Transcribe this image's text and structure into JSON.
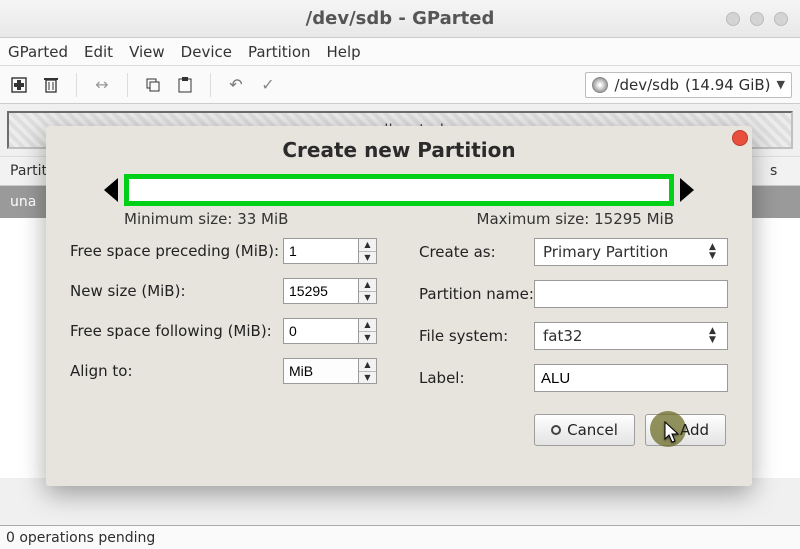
{
  "window": {
    "title": "/dev/sdb - GParted"
  },
  "menu": {
    "app": "GParted",
    "edit": "Edit",
    "view": "View",
    "device": "Device",
    "partition": "Partition",
    "help": "Help"
  },
  "toolbar": {
    "device_name": "/dev/sdb",
    "device_size": "(14.94 GiB)"
  },
  "diskmap": {
    "unallocated": "unallocated"
  },
  "table": {
    "col_partition": "Partit",
    "col_flags": "s",
    "row_first": "una"
  },
  "statusbar": {
    "pending": "0 operations pending"
  },
  "dialog": {
    "title": "Create new Partition",
    "min_size_text": "Minimum size: 33 MiB",
    "max_size_text": "Maximum size: 15295 MiB",
    "labels": {
      "free_preceding": "Free space preceding (MiB):",
      "new_size": "New size (MiB):",
      "free_following": "Free space following (MiB):",
      "align_to": "Align to:",
      "create_as": "Create as:",
      "partition_name": "Partition name:",
      "file_system": "File system:",
      "label": "Label:"
    },
    "values": {
      "free_preceding": "1",
      "new_size": "15295",
      "free_following": "0",
      "align_to": "MiB",
      "create_as": "Primary Partition",
      "partition_name": "",
      "file_system": "fat32",
      "label": "ALU"
    },
    "buttons": {
      "cancel": "Cancel",
      "add": "Add"
    }
  }
}
